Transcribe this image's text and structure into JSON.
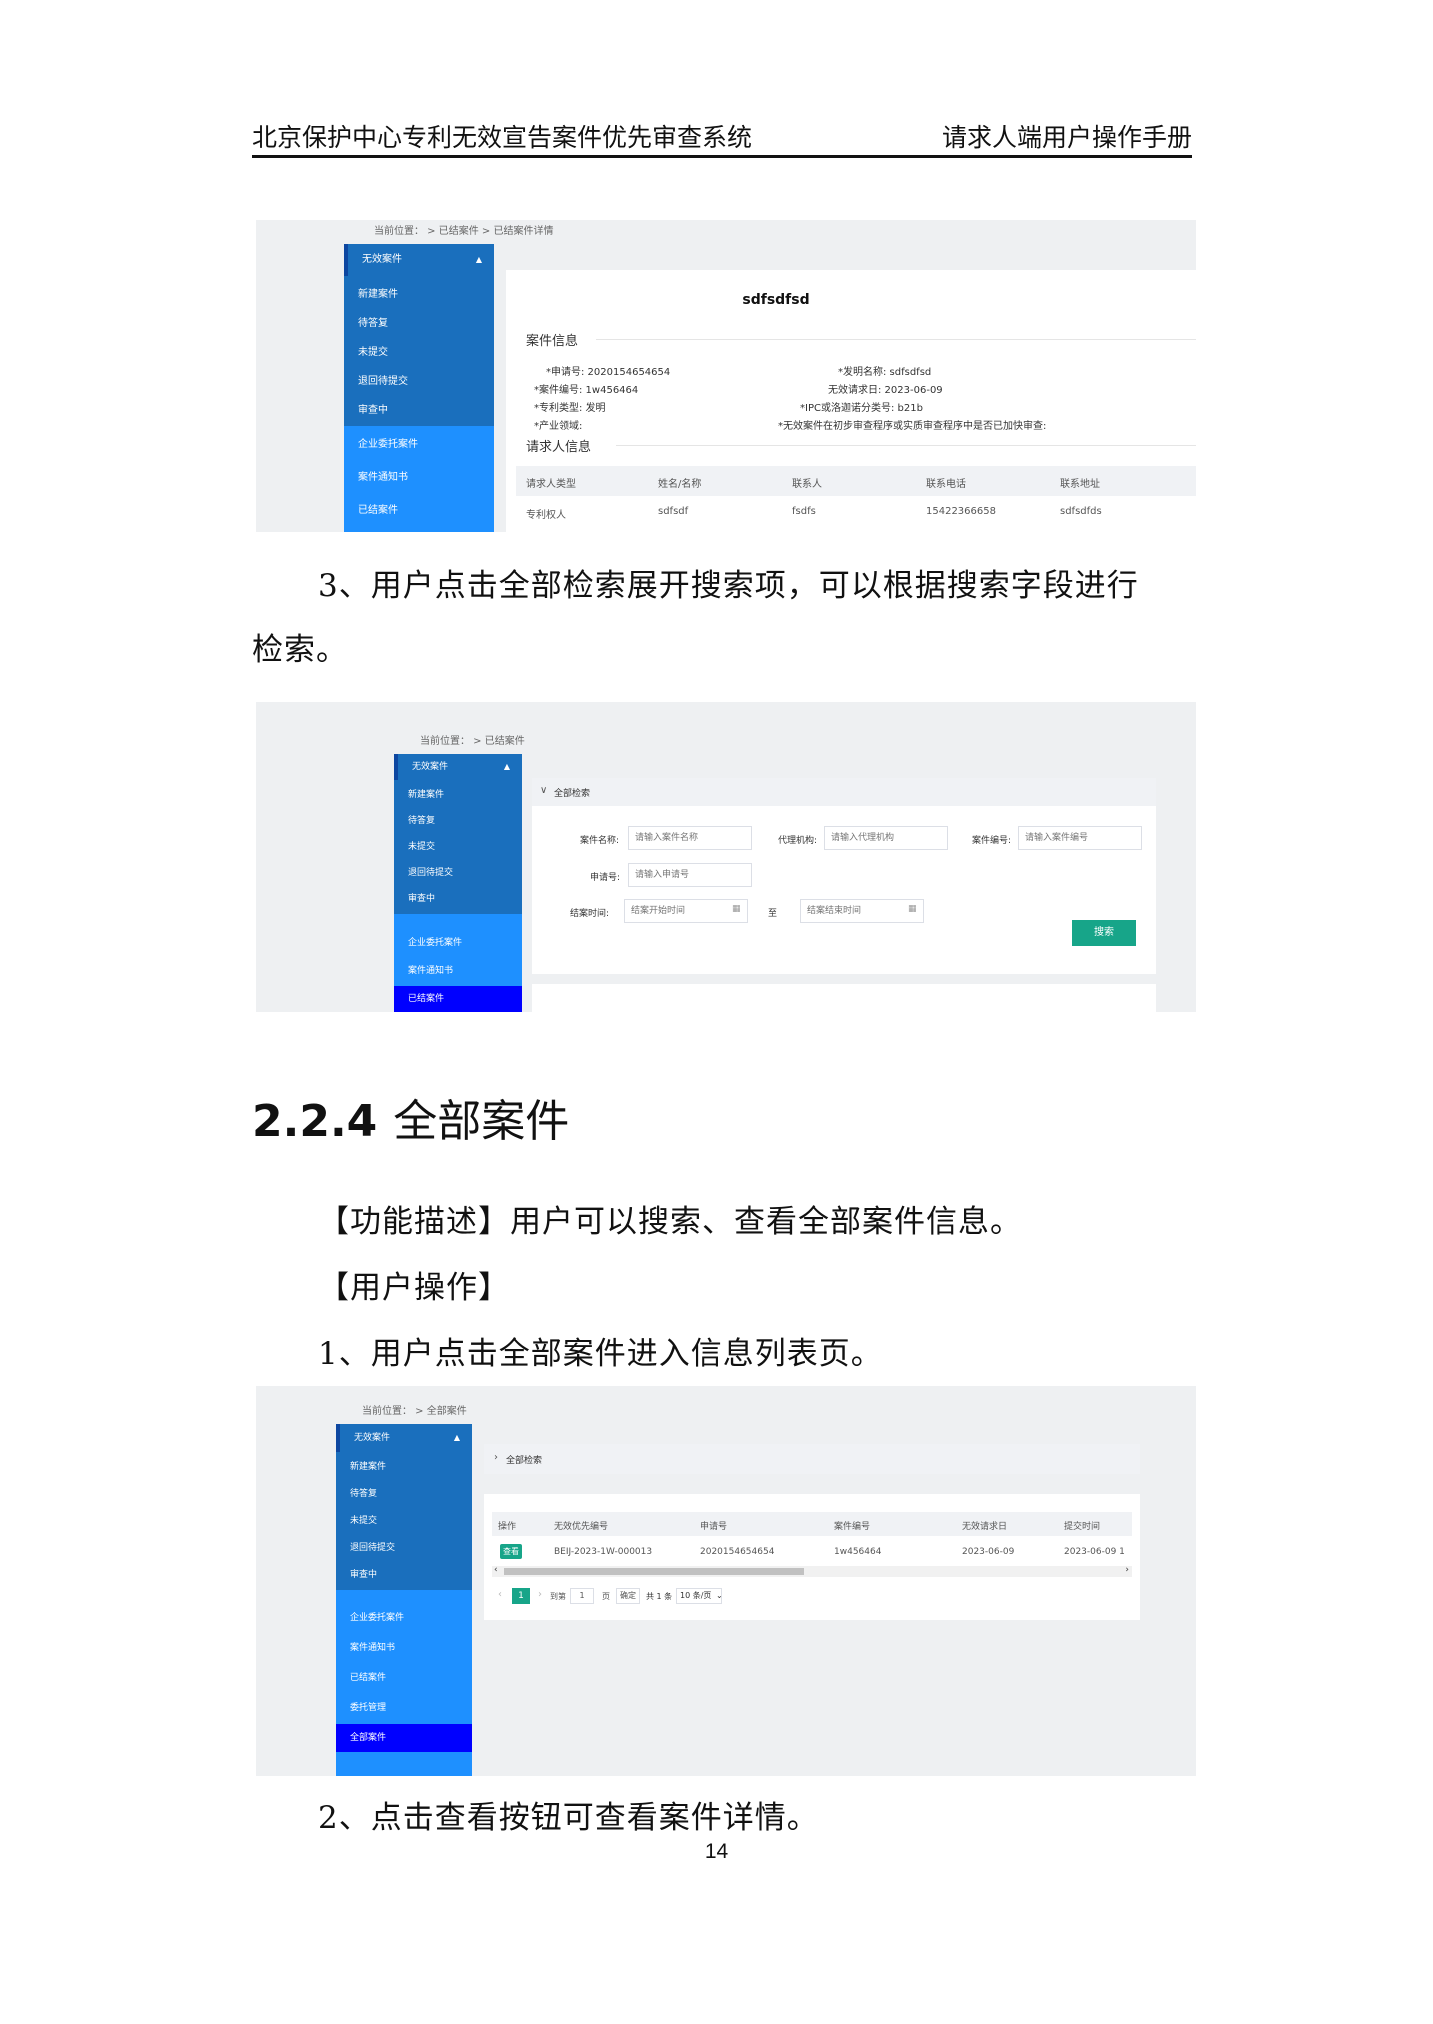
{
  "header": {
    "left": "北京保护中心专利无效宣告案件优先审查系统",
    "right": "请求人端用户操作手册"
  },
  "shot1": {
    "crumb": "当前位置：  >  已结案件  >  已结案件详情",
    "nav": {
      "head": "无效案件",
      "subs": [
        "新建案件",
        "待答复",
        "未提交",
        "退回待提交",
        "审查中"
      ],
      "items": [
        "企业委托案件",
        "案件通知书",
        "已结案件"
      ]
    },
    "case_title": "sdfsdfsd",
    "case_info_title": "案件信息",
    "fields": {
      "app_no": "*申请号: 2020154654654",
      "invention_name": "*发明名称: sdfsdfsd",
      "case_no": "*案件编号: 1w456464",
      "request_date": "无效请求日: 2023-06-09",
      "patent_type": "*专利类型: 发明",
      "ipc": "*IPC或洛迦诺分类号: b21b",
      "industry": "*产业领域:",
      "fast_track": "*无效案件在初步审查程序或实质审查程序中是否已加快审查:"
    },
    "requester_title": "请求人信息",
    "table": {
      "headers": [
        "请求人类型",
        "姓名/名称",
        "联系人",
        "联系电话",
        "联系地址"
      ],
      "row": [
        "专利权人",
        "sdfsdf",
        "fsdfs",
        "15422366658",
        "sdfsdfds"
      ]
    }
  },
  "para3": {
    "line1": "3、用户点击全部检索展开搜索项，可以根据搜索字段进行",
    "line2": "检索。"
  },
  "shot2": {
    "crumb": "当前位置：  >  已结案件",
    "nav": {
      "head": "无效案件",
      "subs": [
        "新建案件",
        "待答复",
        "未提交",
        "退回待提交",
        "审查中"
      ],
      "items": [
        "企业委托案件",
        "案件通知书",
        "已结案件"
      ]
    },
    "search_toggle": "全部检索",
    "labels": {
      "case_name": "案件名称:",
      "agency": "代理机构:",
      "case_no": "案件编号:",
      "app_no": "申请号:",
      "close_time": "结案时间:",
      "to": "至"
    },
    "placeholders": {
      "case_name": "请输入案件名称",
      "agency": "请输入代理机构",
      "case_no": "请输入案件编号",
      "app_no": "请输入申请号",
      "start": "结案开始时间",
      "end": "结案结束时间"
    },
    "search_button": "搜索"
  },
  "section": {
    "number": "2.2.4",
    "title": "全部案件"
  },
  "paras": {
    "desc": "【功能描述】用户可以搜索、查看全部案件信息。",
    "ops": "【用户操作】",
    "step1": "1、用户点击全部案件进入信息列表页。",
    "step2": "2、点击查看按钮可查看案件详情。"
  },
  "shot3": {
    "crumb": "当前位置：  >  全部案件",
    "nav": {
      "head": "无效案件",
      "subs": [
        "新建案件",
        "待答复",
        "未提交",
        "退回待提交",
        "审查中"
      ],
      "items": [
        "企业委托案件",
        "案件通知书",
        "已结案件",
        "委托管理",
        "全部案件"
      ]
    },
    "search_toggle": "全部检索",
    "table": {
      "headers": [
        "操作",
        "无效优先编号",
        "申请号",
        "案件编号",
        "无效请求日",
        "提交时间"
      ],
      "row": [
        "BEIJ-2023-1W-000013",
        "2020154654654",
        "1w456464",
        "2023-06-09",
        "2023-06-09 1"
      ],
      "view_button": "查看"
    },
    "pager": {
      "current": "1",
      "goto": "到第",
      "page_input": "1",
      "page_unit": "页",
      "confirm": "确定",
      "total": "共 1 条",
      "size": "10 条/页"
    }
  },
  "page_number": "14"
}
